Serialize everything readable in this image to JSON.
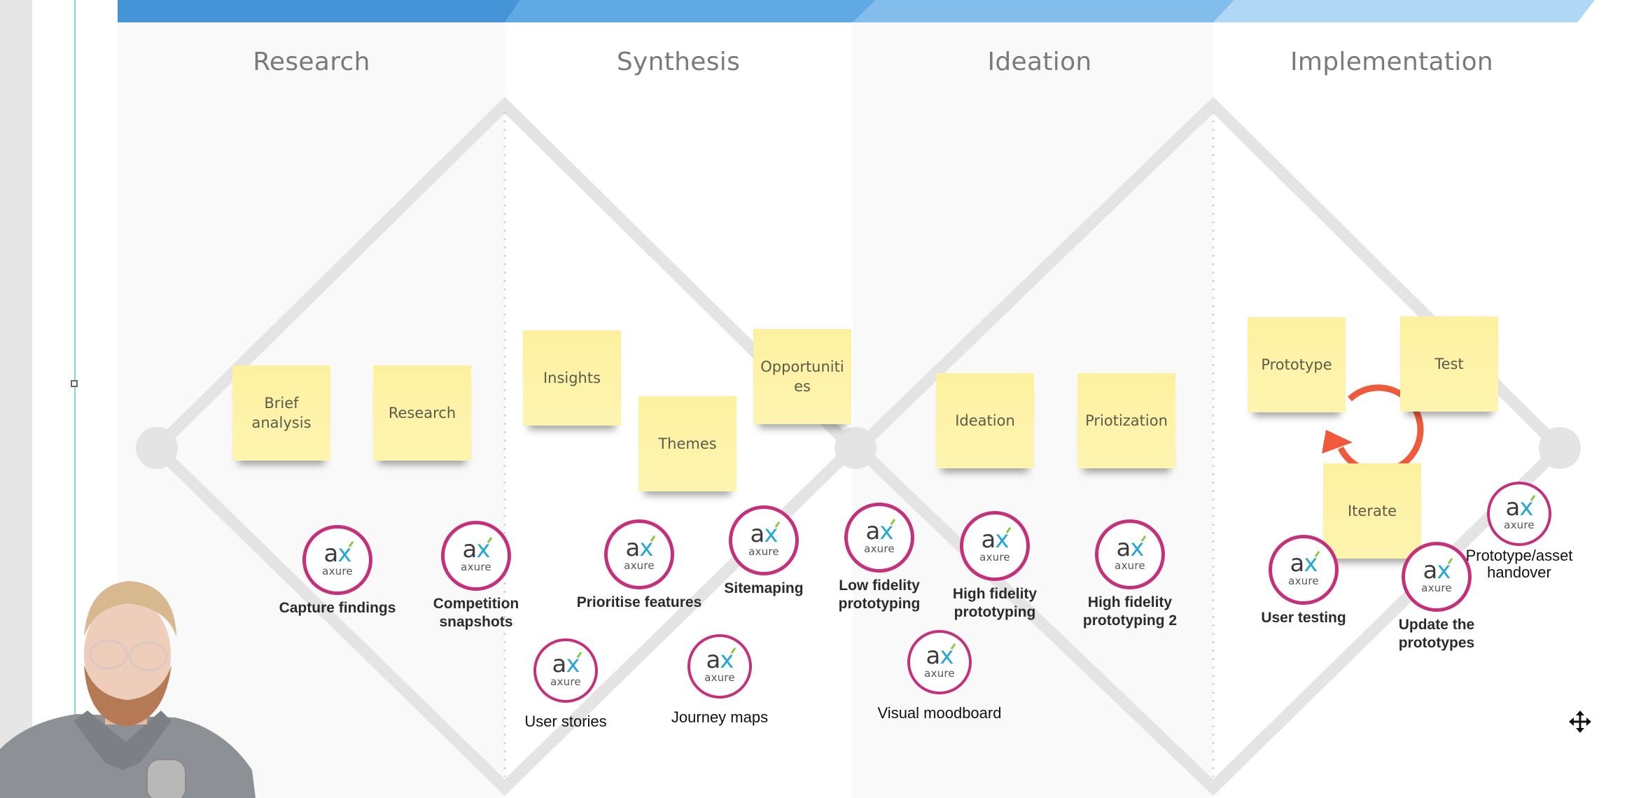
{
  "board": {
    "phases": [
      {
        "title": "Research",
        "banner_color": "#4594d8"
      },
      {
        "title": "Synthesis",
        "banner_color": "#5fa9e4"
      },
      {
        "title": "Ideation",
        "banner_color": "#83bdeb"
      },
      {
        "title": "Implementation",
        "banner_color": "#b0d7f5"
      }
    ],
    "sticky_notes": [
      {
        "text": "Brief analysis",
        "phase": "Research"
      },
      {
        "text": "Research",
        "phase": "Research"
      },
      {
        "text": "Insights",
        "phase": "Synthesis"
      },
      {
        "text": "Themes",
        "phase": "Synthesis"
      },
      {
        "text": "Opportunities",
        "display": "Opportuniti es",
        "phase": "Synthesis"
      },
      {
        "text": "Ideation",
        "phase": "Ideation"
      },
      {
        "text": "Priotization",
        "phase": "Ideation"
      },
      {
        "text": "Prototype",
        "phase": "Implementation"
      },
      {
        "text": "Test",
        "phase": "Implementation"
      },
      {
        "text": "Iterate",
        "phase": "Implementation"
      }
    ],
    "axure_items": [
      {
        "label": "Capture findings",
        "phase": "Research"
      },
      {
        "label": "Competition snapshots",
        "phase": "Research"
      },
      {
        "label": "Prioritise features",
        "phase": "Synthesis"
      },
      {
        "label": "Sitemaping",
        "phase": "Synthesis"
      },
      {
        "label": "User stories",
        "phase": "Synthesis"
      },
      {
        "label": "Journey maps",
        "phase": "Synthesis"
      },
      {
        "label": "Low fidelity prototyping",
        "phase": "Ideation"
      },
      {
        "label": "High fidelity prototyping",
        "phase": "Ideation"
      },
      {
        "label": "High fidelity prototyping 2",
        "phase": "Ideation"
      },
      {
        "label": "Visual moodboard",
        "phase": "Ideation"
      },
      {
        "label": "User testing",
        "phase": "Implementation"
      },
      {
        "label": "Update the prototypes",
        "phase": "Implementation"
      },
      {
        "label": "Prototype/asset handover",
        "phase": "Implementation"
      }
    ],
    "logo": {
      "mark_a": "a",
      "mark_x": "x",
      "word": "axure",
      "ring_color": "#c4307a"
    },
    "cycle_arrow_color": "#ef5a3c",
    "sticky_color": "#fdf3a7"
  },
  "overlay": {
    "webcam": "presenter-webcam"
  }
}
